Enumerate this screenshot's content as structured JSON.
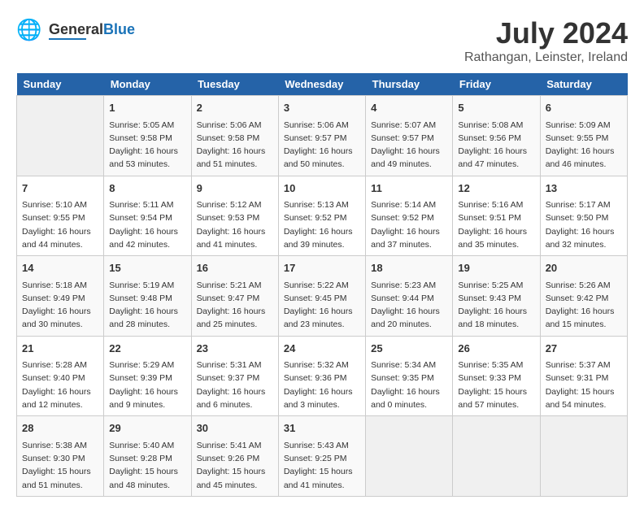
{
  "header": {
    "logo_general": "General",
    "logo_blue": "Blue",
    "month_year": "July 2024",
    "location": "Rathangan, Leinster, Ireland"
  },
  "columns": [
    "Sunday",
    "Monday",
    "Tuesday",
    "Wednesday",
    "Thursday",
    "Friday",
    "Saturday"
  ],
  "weeks": [
    {
      "days": [
        {
          "num": "",
          "info": ""
        },
        {
          "num": "1",
          "info": "Sunrise: 5:05 AM\nSunset: 9:58 PM\nDaylight: 16 hours\nand 53 minutes."
        },
        {
          "num": "2",
          "info": "Sunrise: 5:06 AM\nSunset: 9:58 PM\nDaylight: 16 hours\nand 51 minutes."
        },
        {
          "num": "3",
          "info": "Sunrise: 5:06 AM\nSunset: 9:57 PM\nDaylight: 16 hours\nand 50 minutes."
        },
        {
          "num": "4",
          "info": "Sunrise: 5:07 AM\nSunset: 9:57 PM\nDaylight: 16 hours\nand 49 minutes."
        },
        {
          "num": "5",
          "info": "Sunrise: 5:08 AM\nSunset: 9:56 PM\nDaylight: 16 hours\nand 47 minutes."
        },
        {
          "num": "6",
          "info": "Sunrise: 5:09 AM\nSunset: 9:55 PM\nDaylight: 16 hours\nand 46 minutes."
        }
      ]
    },
    {
      "days": [
        {
          "num": "7",
          "info": "Sunrise: 5:10 AM\nSunset: 9:55 PM\nDaylight: 16 hours\nand 44 minutes."
        },
        {
          "num": "8",
          "info": "Sunrise: 5:11 AM\nSunset: 9:54 PM\nDaylight: 16 hours\nand 42 minutes."
        },
        {
          "num": "9",
          "info": "Sunrise: 5:12 AM\nSunset: 9:53 PM\nDaylight: 16 hours\nand 41 minutes."
        },
        {
          "num": "10",
          "info": "Sunrise: 5:13 AM\nSunset: 9:52 PM\nDaylight: 16 hours\nand 39 minutes."
        },
        {
          "num": "11",
          "info": "Sunrise: 5:14 AM\nSunset: 9:52 PM\nDaylight: 16 hours\nand 37 minutes."
        },
        {
          "num": "12",
          "info": "Sunrise: 5:16 AM\nSunset: 9:51 PM\nDaylight: 16 hours\nand 35 minutes."
        },
        {
          "num": "13",
          "info": "Sunrise: 5:17 AM\nSunset: 9:50 PM\nDaylight: 16 hours\nand 32 minutes."
        }
      ]
    },
    {
      "days": [
        {
          "num": "14",
          "info": "Sunrise: 5:18 AM\nSunset: 9:49 PM\nDaylight: 16 hours\nand 30 minutes."
        },
        {
          "num": "15",
          "info": "Sunrise: 5:19 AM\nSunset: 9:48 PM\nDaylight: 16 hours\nand 28 minutes."
        },
        {
          "num": "16",
          "info": "Sunrise: 5:21 AM\nSunset: 9:47 PM\nDaylight: 16 hours\nand 25 minutes."
        },
        {
          "num": "17",
          "info": "Sunrise: 5:22 AM\nSunset: 9:45 PM\nDaylight: 16 hours\nand 23 minutes."
        },
        {
          "num": "18",
          "info": "Sunrise: 5:23 AM\nSunset: 9:44 PM\nDaylight: 16 hours\nand 20 minutes."
        },
        {
          "num": "19",
          "info": "Sunrise: 5:25 AM\nSunset: 9:43 PM\nDaylight: 16 hours\nand 18 minutes."
        },
        {
          "num": "20",
          "info": "Sunrise: 5:26 AM\nSunset: 9:42 PM\nDaylight: 16 hours\nand 15 minutes."
        }
      ]
    },
    {
      "days": [
        {
          "num": "21",
          "info": "Sunrise: 5:28 AM\nSunset: 9:40 PM\nDaylight: 16 hours\nand 12 minutes."
        },
        {
          "num": "22",
          "info": "Sunrise: 5:29 AM\nSunset: 9:39 PM\nDaylight: 16 hours\nand 9 minutes."
        },
        {
          "num": "23",
          "info": "Sunrise: 5:31 AM\nSunset: 9:37 PM\nDaylight: 16 hours\nand 6 minutes."
        },
        {
          "num": "24",
          "info": "Sunrise: 5:32 AM\nSunset: 9:36 PM\nDaylight: 16 hours\nand 3 minutes."
        },
        {
          "num": "25",
          "info": "Sunrise: 5:34 AM\nSunset: 9:35 PM\nDaylight: 16 hours\nand 0 minutes."
        },
        {
          "num": "26",
          "info": "Sunrise: 5:35 AM\nSunset: 9:33 PM\nDaylight: 15 hours\nand 57 minutes."
        },
        {
          "num": "27",
          "info": "Sunrise: 5:37 AM\nSunset: 9:31 PM\nDaylight: 15 hours\nand 54 minutes."
        }
      ]
    },
    {
      "days": [
        {
          "num": "28",
          "info": "Sunrise: 5:38 AM\nSunset: 9:30 PM\nDaylight: 15 hours\nand 51 minutes."
        },
        {
          "num": "29",
          "info": "Sunrise: 5:40 AM\nSunset: 9:28 PM\nDaylight: 15 hours\nand 48 minutes."
        },
        {
          "num": "30",
          "info": "Sunrise: 5:41 AM\nSunset: 9:26 PM\nDaylight: 15 hours\nand 45 minutes."
        },
        {
          "num": "31",
          "info": "Sunrise: 5:43 AM\nSunset: 9:25 PM\nDaylight: 15 hours\nand 41 minutes."
        },
        {
          "num": "",
          "info": ""
        },
        {
          "num": "",
          "info": ""
        },
        {
          "num": "",
          "info": ""
        }
      ]
    }
  ]
}
